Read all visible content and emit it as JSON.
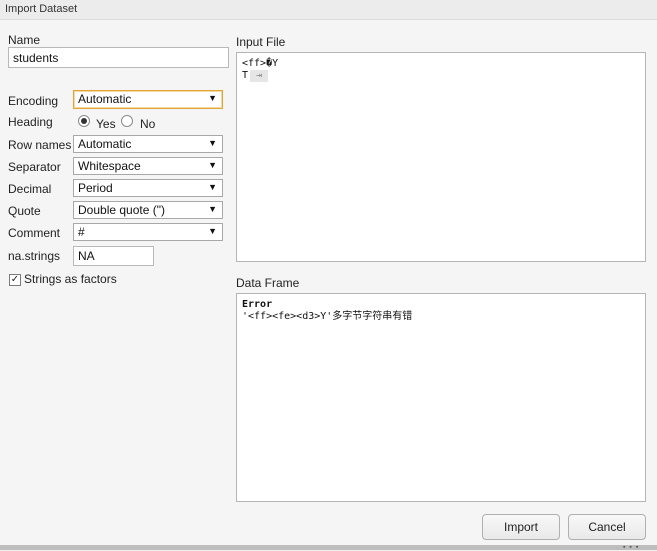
{
  "window": {
    "title": "Import Dataset"
  },
  "form": {
    "name_label": "Name",
    "name_value": "students",
    "encoding_label": "Encoding",
    "encoding_value": "Automatic",
    "heading_label": "Heading",
    "heading_yes": "Yes",
    "heading_no": "No",
    "heading_selected": "Yes",
    "rownames_label": "Row names",
    "rownames_value": "Automatic",
    "separator_label": "Separator",
    "separator_value": "Whitespace",
    "decimal_label": "Decimal",
    "decimal_value": "Period",
    "quote_label": "Quote",
    "quote_value": "Double quote (\")",
    "comment_label": "Comment",
    "comment_value": "#",
    "nastrings_label": "na.strings",
    "nastrings_value": "NA",
    "strings_as_factors_label": "Strings as factors",
    "strings_as_factors_checked": true
  },
  "input_file": {
    "label": "Input File",
    "line1": "<ff>�Y",
    "line2_prefix": "T",
    "line2_tab": "⇥"
  },
  "data_frame": {
    "label": "Data Frame",
    "error_title": "Error",
    "error_message": "'<ff><fe><d3>Y'多字节字符串有错"
  },
  "buttons": {
    "import": "Import",
    "cancel": "Cancel"
  },
  "icons": {
    "dropdown": "caret-down-icon",
    "check": "check-icon"
  }
}
